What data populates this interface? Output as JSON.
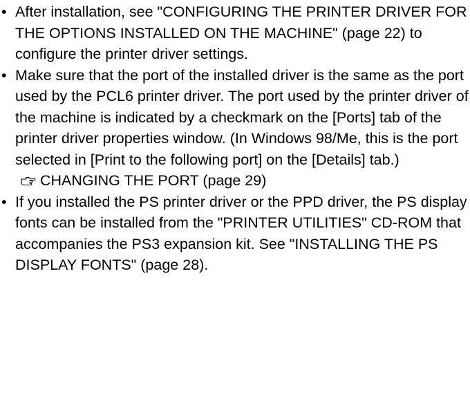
{
  "bullet_symbol": "•",
  "items": [
    {
      "text": "After installation, see \"CONFIGURING THE PRINTER DRIVER FOR THE OPTIONS INSTALLED ON THE MACHINE\" (page 22) to configure the printer driver settings."
    },
    {
      "text": "Make sure that the port of the installed driver is the same as the port used by the PCL6 printer driver. The port used by the printer driver of the machine is indicated by a checkmark on the [Ports] tab of the printer driver properties window. (In Windows 98/Me, this is the port selected in [Print to the following port] on the [Details] tab.)",
      "reference": {
        "icon": "pointing-hand-icon",
        "text": "CHANGING THE PORT (page 29)"
      }
    },
    {
      "text": "If you installed the PS printer driver or the PPD driver, the PS display fonts can be installed from the \"PRINTER UTILITIES\" CD-ROM that accompanies the PS3 expansion kit. See \"INSTALLING THE PS DISPLAY FONTS\" (page 28)."
    }
  ]
}
